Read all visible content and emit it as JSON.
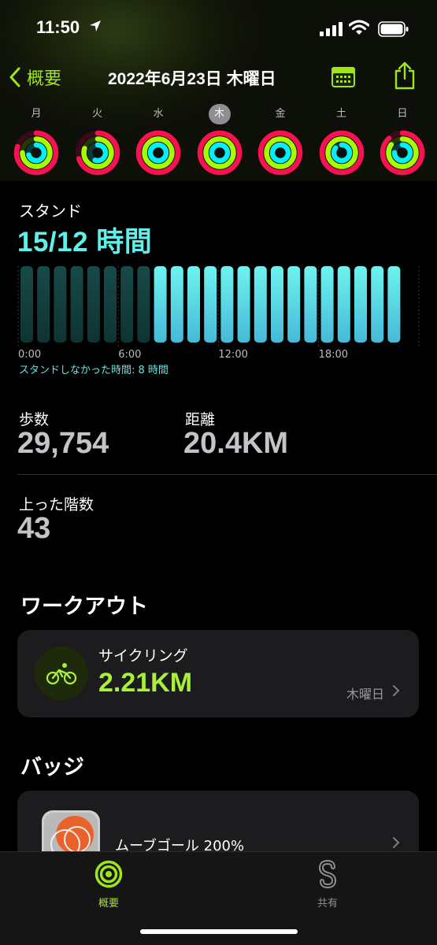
{
  "status_bar": {
    "time": "11:50"
  },
  "nav": {
    "back_label": "概要",
    "title": "2022年6月23日 木曜日"
  },
  "week": {
    "days": [
      {
        "label": "月",
        "move": 0.8,
        "exercise": 0.75,
        "stand": 0.7,
        "selected": false
      },
      {
        "label": "火",
        "move": 0.7,
        "exercise": 0.8,
        "stand": 0.55,
        "selected": false
      },
      {
        "label": "水",
        "move": 1.0,
        "exercise": 1.0,
        "stand": 1.0,
        "selected": false
      },
      {
        "label": "木",
        "move": 1.0,
        "exercise": 1.0,
        "stand": 1.0,
        "selected": true
      },
      {
        "label": "金",
        "move": 1.0,
        "exercise": 1.0,
        "stand": 1.0,
        "selected": false
      },
      {
        "label": "土",
        "move": 1.0,
        "exercise": 1.0,
        "stand": 0.85,
        "selected": false
      },
      {
        "label": "日",
        "move": 0.88,
        "exercise": 0.85,
        "stand": 0.75,
        "selected": false
      }
    ],
    "colors": {
      "move": "#fa114f",
      "exercise": "#a6ff00",
      "stand": "#00f0ff"
    }
  },
  "stand": {
    "title": "スタンド",
    "value": "15/12 時間",
    "note": "スタンドしなかった時間: 8 時間",
    "x_ticks": [
      "0:00",
      "6:00",
      "12:00",
      "18:00"
    ],
    "hours_active": [
      false,
      false,
      false,
      false,
      false,
      false,
      false,
      false,
      true,
      true,
      true,
      true,
      true,
      true,
      true,
      true,
      true,
      true,
      true,
      true,
      true,
      true,
      true
    ]
  },
  "stats": {
    "steps_label": "歩数",
    "steps_value": "29,754",
    "distance_label": "距離",
    "distance_value": "20.4KM",
    "floors_label": "上った階数",
    "floors_value": "43"
  },
  "workouts": {
    "title": "ワークアウト",
    "items": [
      {
        "name": "サイクリング",
        "value": "2.21KM",
        "day": "木曜日"
      }
    ]
  },
  "badges": {
    "title": "バッジ",
    "items": [
      {
        "name": "ムーブゴール 200%"
      }
    ]
  },
  "tabs": [
    {
      "label": "概要",
      "active": true
    },
    {
      "label": "共有",
      "active": false
    }
  ],
  "colors": {
    "accent": "#9fe619",
    "stand": "#5ff0ea"
  }
}
